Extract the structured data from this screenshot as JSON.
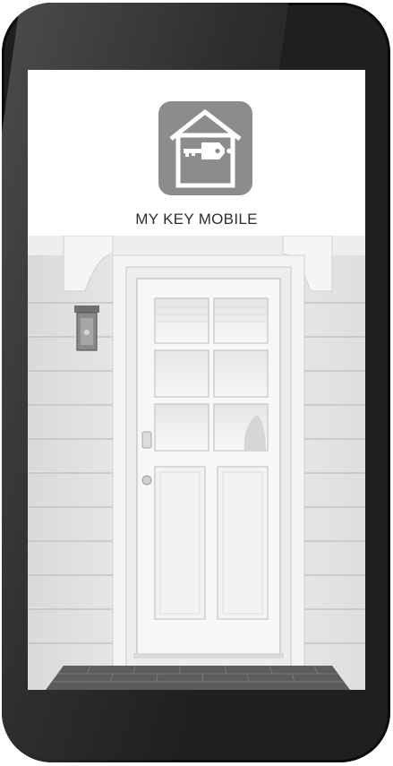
{
  "app": {
    "name": "MY KEY MOBILE",
    "icon": "house-key-icon",
    "colors": {
      "icon_bg": "#8c8c8c",
      "icon_fg": "#ffffff",
      "bezel": "#1f1f1f"
    }
  },
  "splash": {
    "image": "front-door-photo"
  }
}
